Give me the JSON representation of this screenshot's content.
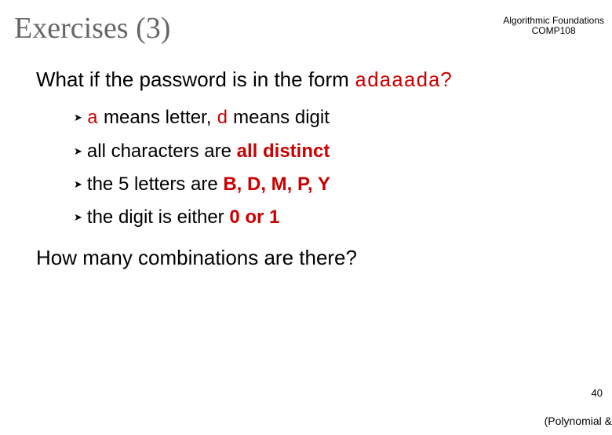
{
  "header": {
    "line1": "Algorithmic Foundations",
    "line2": "COMP108"
  },
  "title": "Exercises (3)",
  "question1": {
    "prefix": "What if the password is in the form ",
    "pattern": "adaaada",
    "suffix": "?"
  },
  "bullets": [
    {
      "parts": [
        {
          "text": "a",
          "cls": "mono"
        },
        {
          "text": " means letter, ",
          "cls": ""
        },
        {
          "text": "d",
          "cls": "mono"
        },
        {
          "text": " means digit",
          "cls": ""
        }
      ]
    },
    {
      "parts": [
        {
          "text": "all characters are ",
          "cls": ""
        },
        {
          "text": "all distinct",
          "cls": "red bold"
        }
      ]
    },
    {
      "parts": [
        {
          "text": "the 5 letters are ",
          "cls": ""
        },
        {
          "text": "B, D, M, P, Y",
          "cls": "red bold"
        }
      ]
    },
    {
      "parts": [
        {
          "text": "the digit is either ",
          "cls": ""
        },
        {
          "text": "0 or 1",
          "cls": "red bold"
        }
      ]
    }
  ],
  "question2": "How many combinations are there?",
  "pagenum": "40",
  "footer": "(Polynomial &"
}
